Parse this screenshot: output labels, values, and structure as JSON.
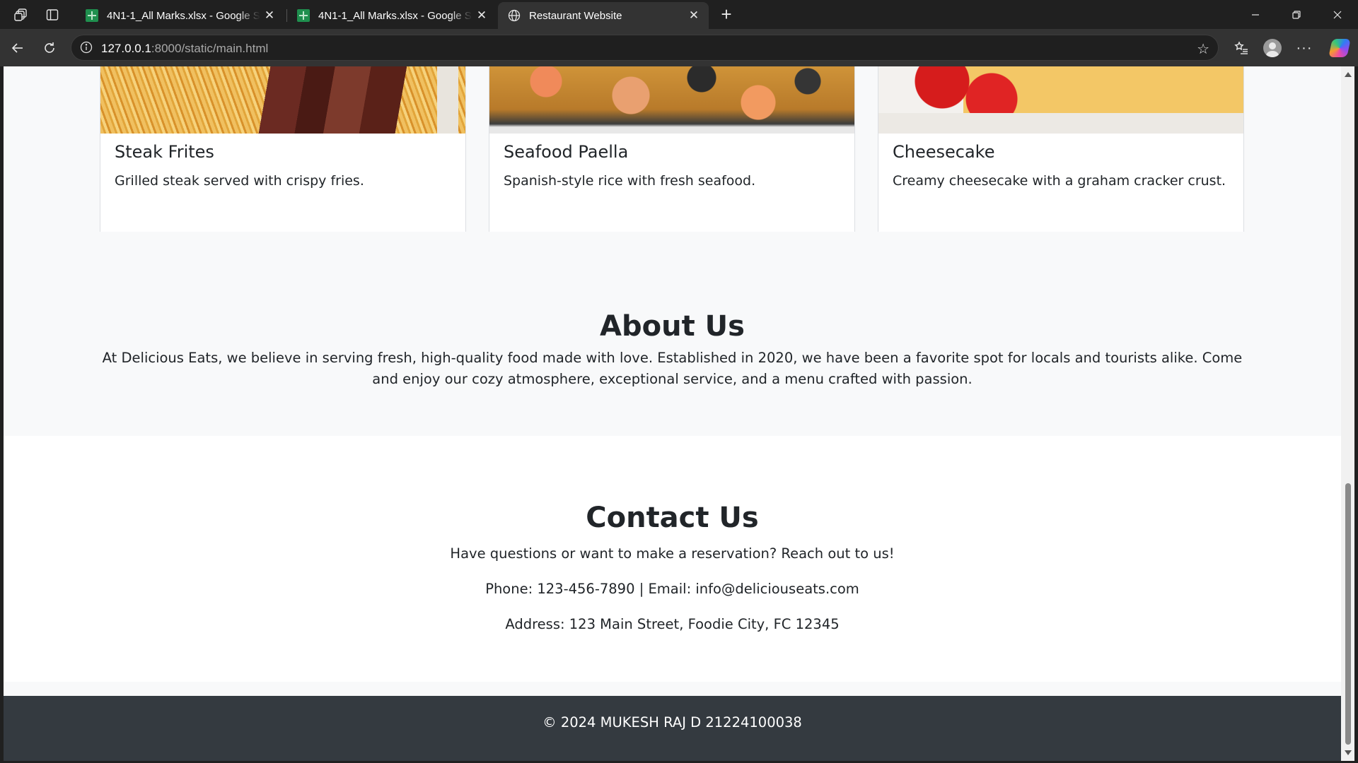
{
  "browser": {
    "tabs": [
      {
        "title": "4N1-1_All Marks.xlsx - Google Sheets",
        "active": false
      },
      {
        "title": "4N1-1_All Marks.xlsx - Google Sheets",
        "active": false
      },
      {
        "title": "Restaurant Website",
        "active": true
      }
    ],
    "url_host": "127.0.0.1",
    "url_rest": ":8000/static/main.html"
  },
  "menu": {
    "cards": [
      {
        "name": "Steak Frites",
        "description": "Grilled steak served with crispy fries."
      },
      {
        "name": "Seafood Paella",
        "description": "Spanish-style rice with fresh seafood."
      },
      {
        "name": "Cheesecake",
        "description": "Creamy cheesecake with a graham cracker crust."
      }
    ]
  },
  "about": {
    "heading": "About Us",
    "text": "At Delicious Eats, we believe in serving fresh, high-quality food made with love. Established in 2020, we have been a favorite spot for locals and tourists alike. Come and enjoy our cozy atmosphere, exceptional service, and a menu crafted with passion."
  },
  "contact": {
    "heading": "Contact Us",
    "intro": "Have questions or want to make a reservation? Reach out to us!",
    "phone_email": "Phone: 123-456-7890 | Email: info@deliciouseats.com",
    "address": "Address: 123 Main Street, Foodie City, FC 12345"
  },
  "footer": {
    "text": "© 2024 MUKESH RAJ D 21224100038"
  },
  "colors": {
    "chrome_dark": "#202020",
    "toolbar": "#333333",
    "page_bg": "#f8f9fa",
    "footer_bg": "#343a40"
  }
}
